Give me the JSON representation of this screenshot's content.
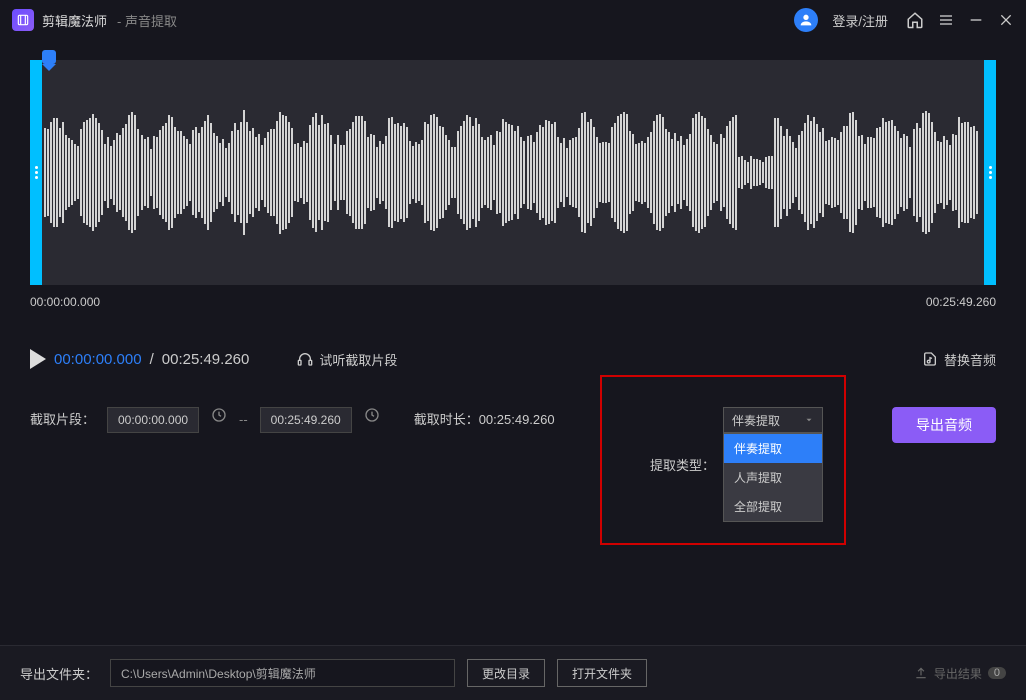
{
  "titlebar": {
    "app_name": "剪辑魔法师",
    "page_title": "声音提取",
    "login_label": "登录/注册"
  },
  "waveform": {
    "start_time": "00:00:00.000",
    "end_time": "00:25:49.260"
  },
  "playback": {
    "current_time": "00:00:00.000",
    "total_time": "00:25:49.260",
    "preview_label": "试听截取片段"
  },
  "replace_audio_label": "替换音频",
  "clip": {
    "label": "截取片段：",
    "start_value": "00:00:00.000",
    "end_value": "00:25:49.260",
    "sep": "--",
    "duration_label": "截取时长：",
    "duration_value": "00:25:49.260"
  },
  "extract": {
    "label": "提取类型：",
    "selected": "伴奏提取",
    "options": [
      "伴奏提取",
      "人声提取",
      "全部提取"
    ]
  },
  "export_button_label": "导出音频",
  "footer": {
    "folder_label": "导出文件夹：",
    "path_value": "C:\\Users\\Admin\\Desktop\\剪辑魔法师",
    "change_dir_label": "更改目录",
    "open_dir_label": "打开文件夹",
    "export_result_label": "导出结果",
    "badge_count": "0"
  },
  "colors": {
    "accent": "#2d7ff9",
    "purple": "#8b5cf6",
    "cyan": "#00bfff"
  }
}
